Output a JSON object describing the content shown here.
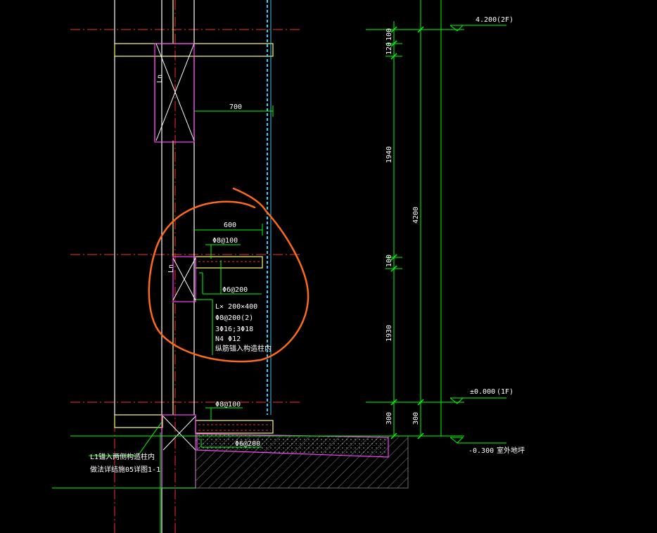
{
  "colors": {
    "background": "#000000",
    "green": "#00ff00",
    "red": "#ff2a2a",
    "yellow": "#ffff66",
    "white": "#ffffff",
    "magenta": "#ff40ff",
    "cyan": "#33ccff",
    "orange": "#ff6a1a",
    "gray": "#bbbbbb"
  },
  "dims": {
    "d700": "700",
    "d600": "600",
    "v100a": "100",
    "v120": "120",
    "v1940": "1940",
    "v4200": "4200",
    "v100b": "100",
    "v1930": "1930",
    "v300a": "300",
    "v300b": "300"
  },
  "levels": {
    "l2f_value": "4.200",
    "l2f_floor": "(2F)",
    "l1f_value": "±0.000",
    "l1f_floor": "(1F)",
    "ground_value": "-0.300",
    "ground_label": "室外地坪"
  },
  "labels": {
    "lin_top": "Ln",
    "lin_mid": "Ln",
    "r8_100_top": "Φ8@100",
    "r6_200_mid": "Φ6@200",
    "beam_lines": [
      "L× 200×400",
      "Φ8@200(2)",
      "3Φ16;3Φ18",
      "N4 Φ12",
      "纵筋锚入构造柱内"
    ],
    "r8_100_bottom": "Φ8@100",
    "r6_200_bottom": "Φ6@200",
    "note_line1": "L1锚入两侧构造柱内",
    "note_line2": "做法详结施05详图1-1"
  }
}
